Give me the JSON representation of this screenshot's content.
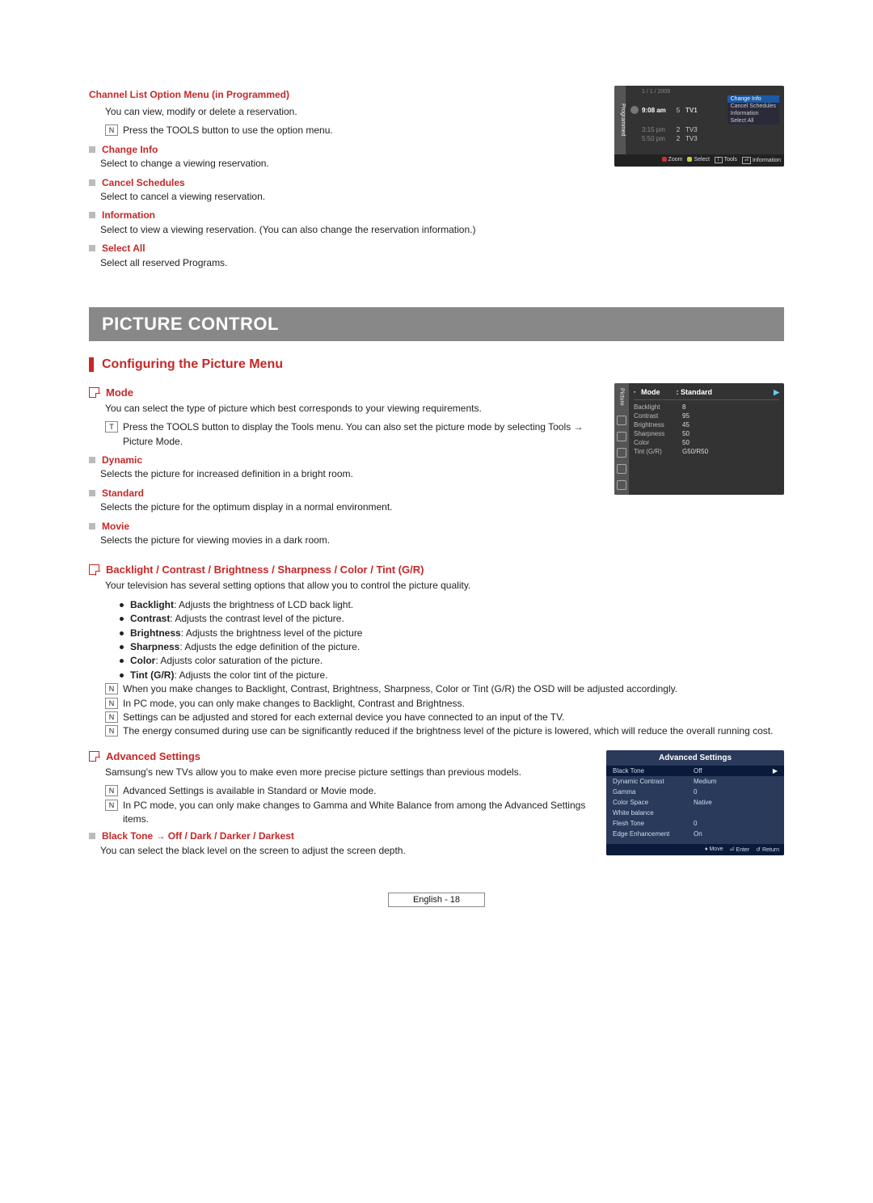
{
  "section1": {
    "title": "Channel List Option Menu (in Programmed)",
    "intro": "You can view, modify or delete a reservation.",
    "tools_note": "Press the TOOLS button to use the option menu.",
    "items": [
      {
        "label": "Change Info",
        "desc": "Select to change a viewing reservation."
      },
      {
        "label": "Cancel Schedules",
        "desc": "Select to cancel a viewing reservation."
      },
      {
        "label": "Information",
        "desc": "Select to view a viewing reservation. (You can also change the reservation information.)"
      },
      {
        "label": "Select All",
        "desc": "Select all reserved Programs."
      }
    ]
  },
  "prog_panel": {
    "side": "Programmed",
    "date": "1 / 1 / 2009",
    "rows": [
      {
        "time": "9:08 am",
        "num": "5",
        "ch": "TV1",
        "menu": true
      },
      {
        "time": "3:15 pm",
        "num": "2",
        "ch": "TV3"
      },
      {
        "time": "5:50 pm",
        "num": "2",
        "ch": "TV3"
      }
    ],
    "menu": {
      "top": "Change Info",
      "subs": [
        "Cancel Schedules",
        "Information",
        "Select All"
      ]
    },
    "footer": {
      "zoom": "Zoom",
      "select": "Select",
      "tools": "Tools",
      "info": "Information"
    }
  },
  "banner": "PICTURE CONTROL",
  "subheading": "Configuring the Picture Menu",
  "mode": {
    "label": "Mode",
    "intro": "You can select the type of picture which best corresponds to your viewing requirements.",
    "tools_note": "Press the TOOLS button to display the Tools menu. You can also set the picture mode by selecting Tools → Picture Mode.",
    "items": [
      {
        "label": "Dynamic",
        "desc": "Selects the picture for increased definition in a bright room."
      },
      {
        "label": "Standard",
        "desc": "Selects the picture for the optimum display in a normal environment."
      },
      {
        "label": "Movie",
        "desc": "Selects the picture for viewing movies in a dark room."
      }
    ]
  },
  "pic_panel": {
    "side": "Picture",
    "head_k": "Mode",
    "head_v": ": Standard",
    "rows": [
      {
        "k": "Backlight",
        "v": "8"
      },
      {
        "k": "Contrast",
        "v": "95"
      },
      {
        "k": "Brightness",
        "v": "45"
      },
      {
        "k": "Sharpness",
        "v": "50"
      },
      {
        "k": "Color",
        "v": "50"
      },
      {
        "k": "Tint (G/R)",
        "v": "G50/R50"
      }
    ]
  },
  "bccs": {
    "label": "Backlight / Contrast / Brightness / Sharpness / Color / Tint (G/R)",
    "intro": "Your television has several setting options that allow you to control the picture quality.",
    "dots": [
      {
        "b": "Backlight",
        "t": ": Adjusts the brightness of LCD back light."
      },
      {
        "b": "Contrast",
        "t": ": Adjusts the contrast level of the picture."
      },
      {
        "b": "Brightness",
        "t": ": Adjusts the brightness level of the picture"
      },
      {
        "b": "Sharpness",
        "t": ": Adjusts the edge definition of the picture."
      },
      {
        "b": "Color",
        "t": ": Adjusts color saturation of the picture."
      },
      {
        "b": "Tint (G/R)",
        "t": ": Adjusts the color tint of the picture."
      }
    ],
    "notes": [
      "When you make changes to Backlight, Contrast, Brightness, Sharpness, Color or Tint (G/R) the OSD will be adjusted accordingly.",
      "In PC mode, you can only make changes to Backlight, Contrast and Brightness.",
      "Settings can be adjusted and stored for each external device you have connected to an input of the TV.",
      "The energy consumed during use can be significantly reduced if the brightness level of the picture is lowered, which will reduce the overall running cost."
    ]
  },
  "adv": {
    "label": "Advanced Settings",
    "intro": "Samsung's new TVs allow you to make even more precise picture settings than previous models.",
    "notes": [
      "Advanced Settings is available in Standard or Movie mode.",
      "In PC mode, you can only make changes to Gamma and White Balance from among the Advanced Settings items."
    ],
    "black_tone_label": "Black Tone → Off / Dark / Darker / Darkest",
    "black_tone_desc": "You can select the black level on the screen to adjust the screen depth."
  },
  "adv_panel": {
    "title": "Advanced Settings",
    "rows": [
      {
        "k": "Black Tone",
        "v": "Off",
        "sel": true
      },
      {
        "k": "Dynamic Contrast",
        "v": "Medium"
      },
      {
        "k": "Gamma",
        "v": "0"
      },
      {
        "k": "Color Space",
        "v": "Native"
      },
      {
        "k": "White balance",
        "v": ""
      },
      {
        "k": "Flesh Tone",
        "v": "0"
      },
      {
        "k": "Edge Enhancement",
        "v": "On"
      }
    ],
    "footer": {
      "move": "Move",
      "enter": "Enter",
      "return": "Return"
    }
  },
  "footer": {
    "lang": "English - 18"
  },
  "glyph": {
    "note": "N",
    "arrow": "▶",
    "tools": "T",
    "updown": "♦",
    "enter": "⏎",
    "ret": "↺"
  }
}
